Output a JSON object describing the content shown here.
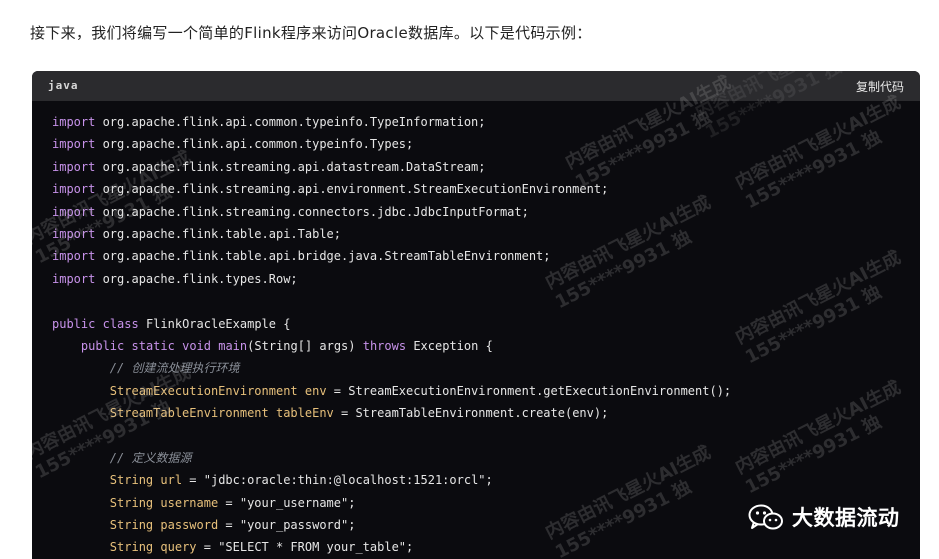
{
  "intro_text": "接下来，我们将编写一个简单的Flink程序来访问Oracle数据库。以下是代码示例：",
  "code_block": {
    "language": "java",
    "copy_label": "复制代码",
    "lines": [
      [
        {
          "t": "import",
          "c": "kw"
        },
        {
          "t": " org.apache.flink.api.common.typeinfo.TypeInformation;",
          "c": "plain"
        }
      ],
      [
        {
          "t": "import",
          "c": "kw"
        },
        {
          "t": " org.apache.flink.api.common.typeinfo.Types;",
          "c": "plain"
        }
      ],
      [
        {
          "t": "import",
          "c": "kw"
        },
        {
          "t": " org.apache.flink.streaming.api.datastream.DataStream;",
          "c": "plain"
        }
      ],
      [
        {
          "t": "import",
          "c": "kw"
        },
        {
          "t": " org.apache.flink.streaming.api.environment.StreamExecutionEnvironment;",
          "c": "plain"
        }
      ],
      [
        {
          "t": "import",
          "c": "kw"
        },
        {
          "t": " org.apache.flink.streaming.connectors.jdbc.JdbcInputFormat;",
          "c": "plain"
        }
      ],
      [
        {
          "t": "import",
          "c": "kw"
        },
        {
          "t": " org.apache.flink.table.api.Table;",
          "c": "plain"
        }
      ],
      [
        {
          "t": "import",
          "c": "kw"
        },
        {
          "t": " org.apache.flink.table.api.bridge.java.StreamTableEnvironment;",
          "c": "plain"
        }
      ],
      [
        {
          "t": "import",
          "c": "kw"
        },
        {
          "t": " org.apache.flink.types.Row;",
          "c": "plain"
        }
      ],
      [],
      [
        {
          "t": "public",
          "c": "kw"
        },
        {
          "t": " ",
          "c": "plain"
        },
        {
          "t": "class",
          "c": "kw"
        },
        {
          "t": " FlinkOracleExample {",
          "c": "plain"
        }
      ],
      [
        {
          "t": "    ",
          "c": "plain"
        },
        {
          "t": "public",
          "c": "kw"
        },
        {
          "t": " ",
          "c": "plain"
        },
        {
          "t": "static",
          "c": "kw"
        },
        {
          "t": " ",
          "c": "plain"
        },
        {
          "t": "void",
          "c": "kw"
        },
        {
          "t": " ",
          "c": "plain"
        },
        {
          "t": "main",
          "c": "kw"
        },
        {
          "t": "(String[] args) ",
          "c": "plain"
        },
        {
          "t": "throws",
          "c": "kw"
        },
        {
          "t": " Exception {",
          "c": "plain"
        }
      ],
      [
        {
          "t": "        // 创建流处理执行环境",
          "c": "comment"
        }
      ],
      [
        {
          "t": "        ",
          "c": "plain"
        },
        {
          "t": "StreamExecutionEnvironment",
          "c": "type"
        },
        {
          "t": " ",
          "c": "plain"
        },
        {
          "t": "env",
          "c": "type"
        },
        {
          "t": " = StreamExecutionEnvironment.getExecutionEnvironment();",
          "c": "plain"
        }
      ],
      [
        {
          "t": "        ",
          "c": "plain"
        },
        {
          "t": "StreamTableEnvironment",
          "c": "type"
        },
        {
          "t": " ",
          "c": "plain"
        },
        {
          "t": "tableEnv",
          "c": "type"
        },
        {
          "t": " = StreamTableEnvironment.create(env);",
          "c": "plain"
        }
      ],
      [],
      [
        {
          "t": "        // 定义数据源",
          "c": "comment"
        }
      ],
      [
        {
          "t": "        ",
          "c": "plain"
        },
        {
          "t": "String",
          "c": "type"
        },
        {
          "t": " ",
          "c": "plain"
        },
        {
          "t": "url",
          "c": "type"
        },
        {
          "t": " = \"jdbc:oracle:thin:@localhost:1521:orcl\";",
          "c": "str"
        }
      ],
      [
        {
          "t": "        ",
          "c": "plain"
        },
        {
          "t": "String",
          "c": "type"
        },
        {
          "t": " ",
          "c": "plain"
        },
        {
          "t": "username",
          "c": "type"
        },
        {
          "t": " = \"your_username\";",
          "c": "str"
        }
      ],
      [
        {
          "t": "        ",
          "c": "plain"
        },
        {
          "t": "String",
          "c": "type"
        },
        {
          "t": " ",
          "c": "plain"
        },
        {
          "t": "password",
          "c": "type"
        },
        {
          "t": " = \"your_password\";",
          "c": "str"
        }
      ],
      [
        {
          "t": "        ",
          "c": "plain"
        },
        {
          "t": "String",
          "c": "type"
        },
        {
          "t": " ",
          "c": "plain"
        },
        {
          "t": "query",
          "c": "type"
        },
        {
          "t": " = \"SELECT * FROM your_table\";",
          "c": "str"
        }
      ]
    ]
  },
  "watermark": {
    "line1": "内容由讯飞星火AI生成",
    "line2": "155****9931 独"
  },
  "brand": {
    "name": "大数据流动",
    "icon": "wechat-icon"
  },
  "colors": {
    "code_bg": "#0b0b0f",
    "header_bg": "#2b2b2e",
    "keyword": "#c792ea",
    "type": "#e7c07b",
    "comment": "#8a8f98"
  }
}
